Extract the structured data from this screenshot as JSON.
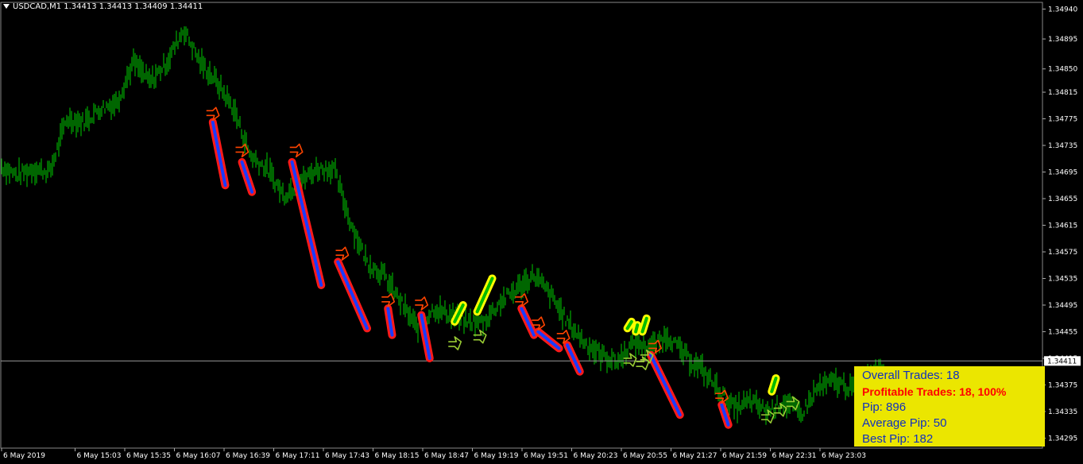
{
  "chart_data": {
    "type": "line",
    "title": "USDCAD,M1  1.34413 1.34413 1.34409 1.34411",
    "symbol": "USDCAD,M1",
    "ohlc": {
      "open": 1.34413,
      "high": 1.34413,
      "low": 1.34409,
      "close": 1.34411
    },
    "current_price": 1.34411,
    "ylim": [
      1.3428,
      1.3495
    ],
    "y_ticks": [
      "1.34940",
      "1.34895",
      "1.34850",
      "1.34815",
      "1.34775",
      "1.34735",
      "1.34695",
      "1.34655",
      "1.34615",
      "1.34575",
      "1.34535",
      "1.34495",
      "1.34455",
      "1.34415",
      "1.34375",
      "1.34335",
      "1.34295"
    ],
    "x_ticks": [
      "6 May 2019",
      "6 May 15:03",
      "6 May 15:35",
      "6 May 16:07",
      "6 May 16:39",
      "6 May 17:11",
      "6 May 17:43",
      "6 May 18:15",
      "6 May 18:47",
      "6 May 19:19",
      "6 May 19:51",
      "6 May 20:23",
      "6 May 20:55",
      "6 May 21:27",
      "6 May 21:59",
      "6 May 22:31",
      "6 May 23:03"
    ],
    "colors": {
      "price": "#00cc00",
      "sell_trade": "#ff1a1a",
      "sell_fill": "#1a3cff",
      "buy_trade": "#ffff00",
      "buy_fill": "#00bb00",
      "sell_arrow": "#ff4400",
      "buy_arrow": "#99cc33"
    },
    "price_path": [
      [
        0,
        1.34705
      ],
      [
        0.02,
        1.3469
      ],
      [
        0.04,
        1.347
      ],
      [
        0.06,
        1.34695
      ],
      [
        0.08,
        1.34775
      ],
      [
        0.1,
        1.3477
      ],
      [
        0.12,
        1.3479
      ],
      [
        0.14,
        1.348
      ],
      [
        0.16,
        1.3486
      ],
      [
        0.18,
        1.3483
      ],
      [
        0.2,
        1.3486
      ],
      [
        0.22,
        1.3491
      ],
      [
        0.24,
        1.3486
      ],
      [
        0.26,
        1.3483
      ],
      [
        0.28,
        1.3479
      ],
      [
        0.3,
        1.3472
      ],
      [
        0.32,
        1.347
      ],
      [
        0.34,
        1.3466
      ],
      [
        0.36,
        1.3468
      ],
      [
        0.38,
        1.347
      ],
      [
        0.4,
        1.347
      ],
      [
        0.42,
        1.3462
      ],
      [
        0.44,
        1.3456
      ],
      [
        0.46,
        1.3454
      ],
      [
        0.48,
        1.345
      ],
      [
        0.5,
        1.3446
      ],
      [
        0.52,
        1.3449
      ],
      [
        0.54,
        1.3448
      ],
      [
        0.56,
        1.3447
      ],
      [
        0.58,
        1.3447
      ],
      [
        0.6,
        1.345
      ],
      [
        0.62,
        1.3452
      ],
      [
        0.64,
        1.3454
      ],
      [
        0.66,
        1.3451
      ],
      [
        0.68,
        1.3447
      ],
      [
        0.7,
        1.3444
      ],
      [
        0.72,
        1.3442
      ],
      [
        0.74,
        1.3441
      ],
      [
        0.76,
        1.3444
      ],
      [
        0.78,
        1.3443
      ],
      [
        0.8,
        1.3445
      ],
      [
        0.82,
        1.3442
      ],
      [
        0.84,
        1.344
      ],
      [
        0.86,
        1.3437
      ],
      [
        0.88,
        1.3434
      ],
      [
        0.9,
        1.3435
      ],
      [
        0.92,
        1.34335
      ],
      [
        0.94,
        1.3435
      ],
      [
        0.96,
        1.3433
      ],
      [
        0.98,
        1.3437
      ],
      [
        1.0,
        1.3438
      ],
      [
        1.02,
        1.3437
      ],
      [
        1.04,
        1.3439
      ],
      [
        1.06,
        1.34411
      ]
    ],
    "sell_trades": [
      [
        0.255,
        1.3477,
        0.27,
        1.34675
      ],
      [
        0.29,
        1.3471,
        0.302,
        1.34665
      ],
      [
        0.35,
        1.3471,
        0.385,
        1.34525
      ],
      [
        0.405,
        1.3456,
        0.44,
        1.3446
      ],
      [
        0.465,
        1.3449,
        0.47,
        1.3445
      ],
      [
        0.505,
        1.3448,
        0.515,
        1.34415
      ],
      [
        0.625,
        1.3449,
        0.64,
        1.3445
      ],
      [
        0.645,
        1.34455,
        0.67,
        1.3443
      ],
      [
        0.68,
        1.34435,
        0.695,
        1.34395
      ],
      [
        0.78,
        1.3442,
        0.815,
        1.3433
      ],
      [
        0.865,
        1.34345,
        0.873,
        1.34315
      ]
    ],
    "buy_trades": [
      [
        0.545,
        1.3447,
        0.555,
        1.34495
      ],
      [
        0.572,
        1.34485,
        0.59,
        1.34535
      ],
      [
        0.752,
        1.3446,
        0.757,
        1.3447
      ],
      [
        0.762,
        1.34455,
        0.764,
        1.34465
      ],
      [
        0.77,
        1.34455,
        0.775,
        1.34475
      ],
      [
        0.925,
        1.34365,
        0.93,
        1.34385
      ]
    ],
    "sell_arrows": [
      [
        0.255,
        1.3478
      ],
      [
        0.29,
        1.34725
      ],
      [
        0.355,
        1.34725
      ],
      [
        0.41,
        1.3457
      ],
      [
        0.465,
        1.345
      ],
      [
        0.505,
        1.34495
      ],
      [
        0.625,
        1.345
      ],
      [
        0.645,
        1.34465
      ],
      [
        0.675,
        1.34445
      ],
      [
        0.785,
        1.3443
      ],
      [
        0.865,
        1.34355
      ]
    ],
    "buy_arrows": [
      [
        0.545,
        1.3444
      ],
      [
        0.575,
        1.3445
      ],
      [
        0.755,
        1.34415
      ],
      [
        0.77,
        1.3441
      ],
      [
        0.775,
        1.3442
      ],
      [
        0.92,
        1.3433
      ],
      [
        0.935,
        1.3434
      ],
      [
        0.95,
        1.3435
      ]
    ]
  },
  "stats": {
    "overall": "Overall Trades: 18",
    "profitable": "Profitable Trades: 18, 100%",
    "pip": "Pip: 896",
    "average": "Average Pip: 50",
    "best": "Best Pip: 182"
  }
}
